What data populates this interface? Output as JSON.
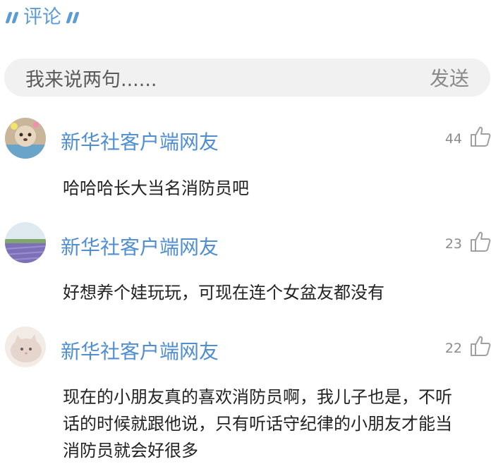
{
  "header": {
    "title": "评论"
  },
  "input": {
    "placeholder": "我来说两句......",
    "send_label": "发送"
  },
  "comments": [
    {
      "user": "新华社客户端网友",
      "likes": "44",
      "text": "哈哈哈长大当名消防员吧",
      "avatar": "dog-avatar"
    },
    {
      "user": "新华社客户端网友",
      "likes": "23",
      "text": "好想养个娃玩玩，可现在连个女盆友都没有",
      "avatar": "lavender-field-avatar"
    },
    {
      "user": "新华社客户端网友",
      "likes": "22",
      "text": "现在的小朋友真的喜欢消防员啊，我儿子也是，不听话的时候就跟他说，只有听话守纪律的小朋友才能当消防员就会好很多",
      "avatar": "cat-avatar"
    }
  ],
  "colors": {
    "accent": "#5b9bd8",
    "username": "#4f8ed1",
    "input_bg": "#f1f1f1"
  }
}
